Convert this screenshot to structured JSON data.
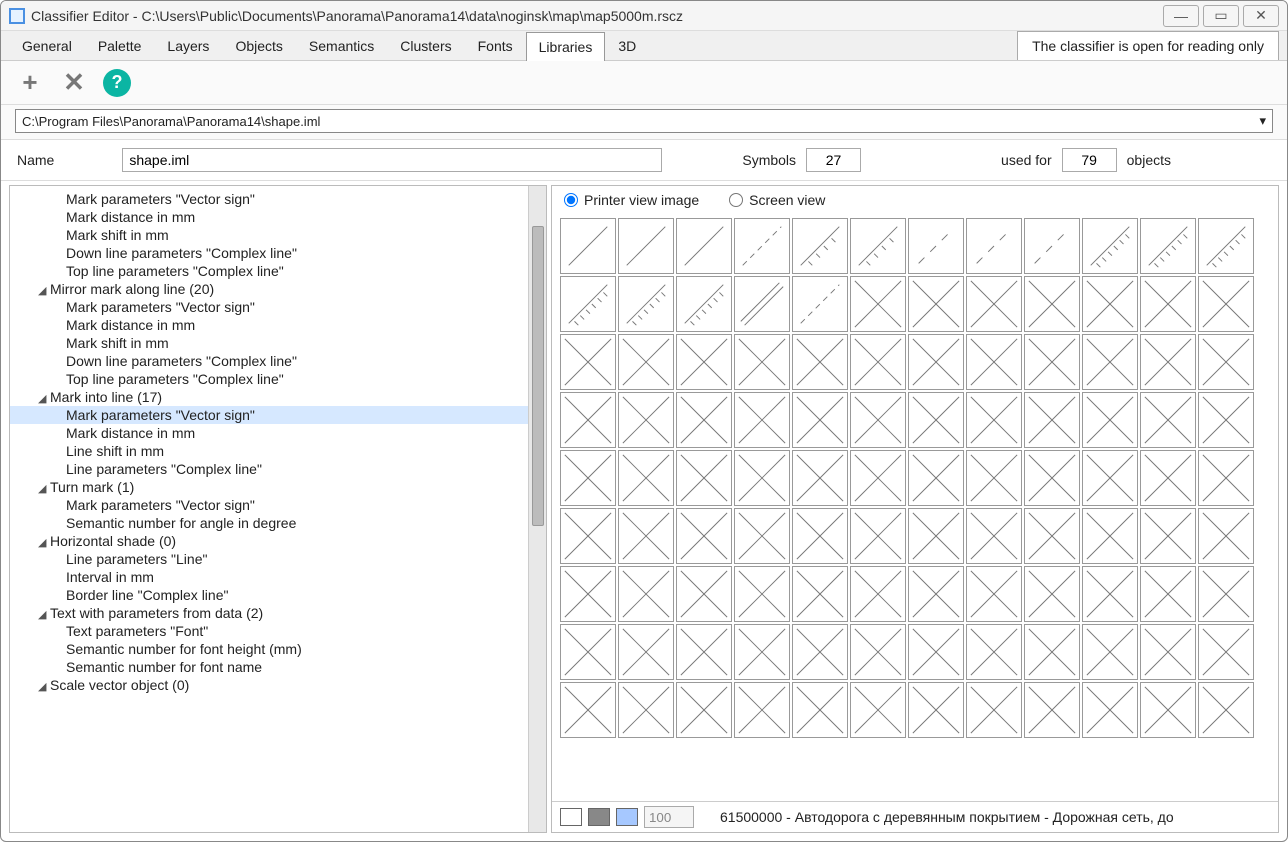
{
  "window": {
    "title": "Classifier Editor - C:\\Users\\Public\\Documents\\Panorama\\Panorama14\\data\\noginsk\\map\\map5000m.rscz"
  },
  "tabs": [
    "General",
    "Palette",
    "Layers",
    "Objects",
    "Semantics",
    "Clusters",
    "Fonts",
    "Libraries",
    "3D"
  ],
  "active_tab": "Libraries",
  "readonly_notice": "The classifier is open for reading only",
  "path": "C:\\Program Files\\Panorama\\Panorama14\\shape.iml",
  "info": {
    "name_label": "Name",
    "name_value": "shape.iml",
    "symbols_label": "Symbols",
    "symbols_value": "27",
    "usedfor_label": "used for",
    "usedfor_value": "79",
    "objects_label": "objects"
  },
  "view": {
    "printer_label": "Printer view image",
    "screen_label": "Screen view",
    "selected": "printer"
  },
  "tree": [
    {
      "depth": 2,
      "text": "Mark parameters \"Vector sign\""
    },
    {
      "depth": 2,
      "text": "Mark distance in mm"
    },
    {
      "depth": 2,
      "text": "Mark shift in mm"
    },
    {
      "depth": 2,
      "text": "Down line parameters \"Complex line\""
    },
    {
      "depth": 2,
      "text": "Top line parameters \"Complex line\""
    },
    {
      "depth": 1,
      "text": "Mirror mark along line (20)",
      "expanded": true
    },
    {
      "depth": 2,
      "text": "Mark parameters \"Vector sign\""
    },
    {
      "depth": 2,
      "text": "Mark distance in mm"
    },
    {
      "depth": 2,
      "text": "Mark shift in mm"
    },
    {
      "depth": 2,
      "text": "Down line parameters \"Complex line\""
    },
    {
      "depth": 2,
      "text": "Top line parameters \"Complex line\""
    },
    {
      "depth": 1,
      "text": "Mark into line (17)",
      "expanded": true
    },
    {
      "depth": 2,
      "text": "Mark parameters \"Vector sign\"",
      "selected": true
    },
    {
      "depth": 2,
      "text": "Mark distance in mm"
    },
    {
      "depth": 2,
      "text": "Line shift in mm"
    },
    {
      "depth": 2,
      "text": "Line parameters \"Complex line\""
    },
    {
      "depth": 1,
      "text": "Turn mark (1)",
      "expanded": true
    },
    {
      "depth": 2,
      "text": "Mark parameters \"Vector sign\""
    },
    {
      "depth": 2,
      "text": "Semantic number for angle in degree"
    },
    {
      "depth": 1,
      "text": "Horizontal shade (0)",
      "expanded": true
    },
    {
      "depth": 2,
      "text": "Line parameters \"Line\""
    },
    {
      "depth": 2,
      "text": "Interval in mm"
    },
    {
      "depth": 2,
      "text": "Border line \"Complex line\""
    },
    {
      "depth": 1,
      "text": "Text with parameters from data (2)",
      "expanded": true
    },
    {
      "depth": 2,
      "text": "Text parameters \"Font\""
    },
    {
      "depth": 2,
      "text": "Semantic number for font height (mm)"
    },
    {
      "depth": 2,
      "text": "Semantic number for font name"
    },
    {
      "depth": 1,
      "text": "Scale vector object (0)",
      "expanded": true
    }
  ],
  "symbol_types": [
    "single",
    "single",
    "single",
    "dashed",
    "tram",
    "tram",
    "dot_spaced",
    "dot_spaced",
    "dot_spaced",
    "rail",
    "rail",
    "rail",
    "rail",
    "rail",
    "rail",
    "double",
    "dashed",
    "empty",
    "empty",
    "empty",
    "empty",
    "empty",
    "empty",
    "empty"
  ],
  "grid_rows": 9,
  "grid_cols": 12,
  "bottom": {
    "scale_value": "100",
    "status_text": "61500000 - Автодорога с деревянным покрытием - Дорожная сеть, до"
  }
}
